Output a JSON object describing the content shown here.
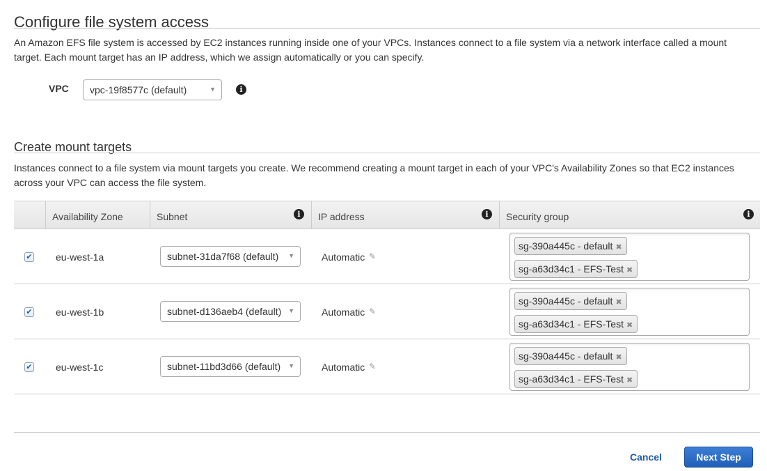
{
  "page": {
    "title": "Configure file system access",
    "intro": "An Amazon EFS file system is accessed by EC2 instances running inside one of your VPCs. Instances connect to a file system via a network interface called a mount target. Each mount target has an IP address, which we assign automatically or you can specify."
  },
  "vpc": {
    "label": "VPC",
    "selected": "vpc-19f8577c (default)",
    "info_icon": "info-icon"
  },
  "mount_targets": {
    "title": "Create mount targets",
    "description": "Instances connect to a file system via mount targets you create. We recommend creating a mount target in each of your VPC's Availability Zones so that EC2 instances across your VPC can access the file system.",
    "columns": [
      "",
      "Availability Zone",
      "Subnet",
      "IP address",
      "Security group"
    ],
    "rows": [
      {
        "checked": true,
        "az": "eu-west-1a",
        "subnet": "subnet-31da7f68 (default)",
        "ip": "Automatic",
        "security_groups": [
          "sg-390a445c - default",
          "sg-a63d34c1 - EFS-Test"
        ]
      },
      {
        "checked": true,
        "az": "eu-west-1b",
        "subnet": "subnet-d136aeb4 (default)",
        "ip": "Automatic",
        "security_groups": [
          "sg-390a445c - default",
          "sg-a63d34c1 - EFS-Test"
        ]
      },
      {
        "checked": true,
        "az": "eu-west-1c",
        "subnet": "subnet-11bd3d66 (default)",
        "ip": "Automatic",
        "security_groups": [
          "sg-390a445c - default",
          "sg-a63d34c1 - EFS-Test"
        ]
      }
    ]
  },
  "footer": {
    "cancel_label": "Cancel",
    "next_label": "Next Step"
  },
  "icons": {
    "info": "i",
    "caret": "▼",
    "check": "✔",
    "pencil": "✎",
    "remove": "✖"
  },
  "colors": {
    "primary": "#1f5fb8",
    "link": "#1e5aa8"
  }
}
